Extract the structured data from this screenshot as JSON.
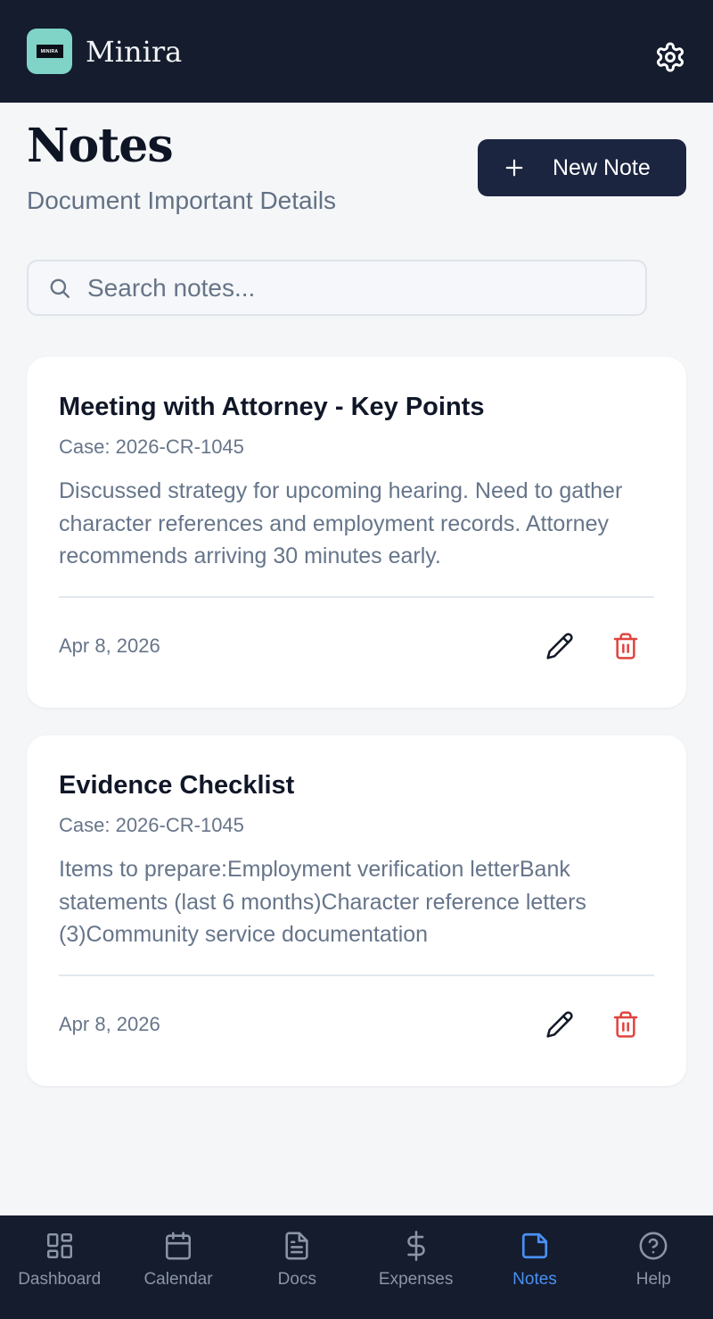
{
  "app": {
    "logo_text": "MINIRA",
    "name": "Minira"
  },
  "page": {
    "title": "Notes",
    "subtitle": "Document Important Details",
    "new_note_label": "New Note"
  },
  "search": {
    "placeholder": "Search notes...",
    "value": ""
  },
  "notes": [
    {
      "title": "Meeting with Attorney - Key Points",
      "case": "Case: 2026-CR-1045",
      "body": "Discussed strategy for upcoming hearing. Need to gather character references and employment records. Attorney recommends arriving 30 minutes early.",
      "date": "Apr 8, 2026"
    },
    {
      "title": "Evidence Checklist",
      "case": "Case: 2026-CR-1045",
      "body": "Items to prepare:Employment verification letterBank statements (last 6 months)Character reference letters (3)Community service documentation",
      "date": "Apr 8, 2026"
    }
  ],
  "nav": {
    "items": [
      {
        "label": "Dashboard",
        "icon": "dashboard-icon"
      },
      {
        "label": "Calendar",
        "icon": "calendar-icon"
      },
      {
        "label": "Docs",
        "icon": "document-icon"
      },
      {
        "label": "Expenses",
        "icon": "dollar-icon"
      },
      {
        "label": "Notes",
        "icon": "note-icon",
        "active": true
      },
      {
        "label": "Help",
        "icon": "help-icon"
      }
    ]
  },
  "colors": {
    "header_bg": "#141c2e",
    "accent_teal": "#7fd3c7",
    "primary_button": "#1b2540",
    "delete_red": "#e0443e",
    "nav_active": "#4a90f2",
    "nav_inactive": "#8b95a6"
  }
}
